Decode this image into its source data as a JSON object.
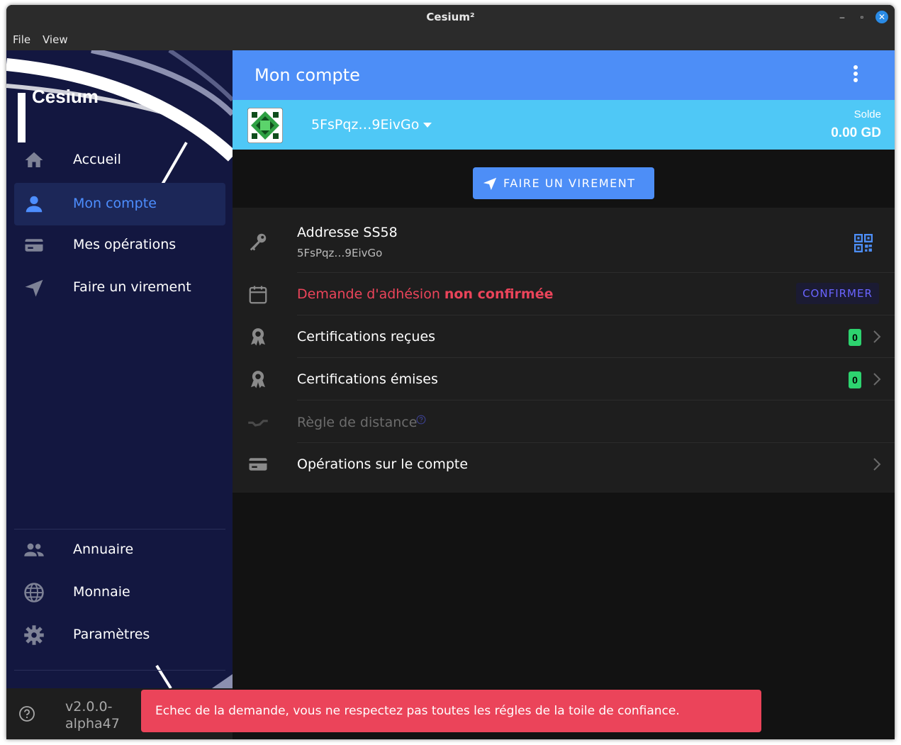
{
  "window": {
    "title": "Cesium²"
  },
  "menubar": {
    "items": [
      "File",
      "View"
    ]
  },
  "sidebar": {
    "logo": "Cesium",
    "items": [
      {
        "label": "Accueil",
        "icon": "home-icon"
      },
      {
        "label": "Mon compte",
        "icon": "person-icon",
        "active": true
      },
      {
        "label": "Mes opérations",
        "icon": "card-icon"
      },
      {
        "label": "Faire un virement",
        "icon": "send-icon"
      }
    ],
    "bottom_items": [
      {
        "label": "Annuaire",
        "icon": "people-icon"
      },
      {
        "label": "Monnaie",
        "icon": "globe-icon"
      },
      {
        "label": "Paramètres",
        "icon": "settings-icon"
      }
    ],
    "version": "v2.0.0-alpha47"
  },
  "toolbar": {
    "title": "Mon compte"
  },
  "account": {
    "name": "5FsPqz…9EivGo",
    "balance_label": "Solde",
    "balance": "0.00 GD"
  },
  "transfer_button": "FAIRE UN VIREMENT",
  "list": {
    "address": {
      "title": "Addresse SS58",
      "value": "5FsPqz…9EivGo"
    },
    "membership": {
      "text_prefix": "Demande d'adhésion ",
      "text_bold": "non confirmée",
      "button": "CONFIRMER"
    },
    "cert_received": {
      "label": "Certifications reçues",
      "count": "0"
    },
    "cert_issued": {
      "label": "Certifications émises",
      "count": "0"
    },
    "distance": {
      "label": "Règle de distance"
    },
    "operations": {
      "label": "Opérations sur le compte"
    }
  },
  "toast": {
    "message": "Echec de la demande, vous ne respectez pas toutes les régles de la toile de confiance."
  },
  "colors": {
    "primary": "#4d8ef7",
    "secondary": "#4fc8f6",
    "danger": "#eb445a",
    "success": "#2dd36f",
    "sidebar_bg": "#131740"
  }
}
